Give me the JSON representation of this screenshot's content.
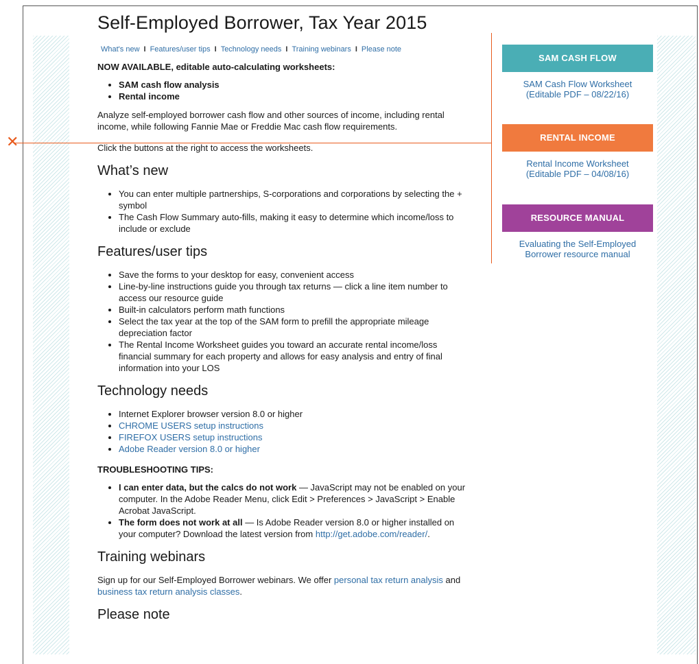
{
  "page_title": "Self-Employed Borrower, Tax Year 2015",
  "topnav": [
    "What's new",
    "Features/user tips",
    "Technology needs",
    "Training webinars",
    "Please note"
  ],
  "topnav_sep": "I",
  "now_available": "NOW AVAILABLE, editable auto-calculating worksheets:",
  "worksheets": [
    "SAM cash flow analysis",
    "Rental income"
  ],
  "intro": "Analyze self-employed borrower cash flow and other sources of income, including rental income, while following Fannie Mae or Freddie Mac cash flow requirements.",
  "click_text": "Click the buttons at the right to access the worksheets.",
  "whats_new": {
    "heading": "What’s new",
    "items": [
      "You can enter multiple partnerships, S-corporations and corporations by selecting the + symbol",
      "The Cash Flow Summary auto-fills, making it easy to determine which income/loss to include or exclude"
    ]
  },
  "features": {
    "heading": "Features/user tips",
    "items": [
      "Save the forms to your desktop for easy, convenient access",
      "Line-by-line instructions guide you through tax returns — click a line item number to access our resource guide",
      "Built-in calculators perform math functions",
      "Select the tax year at the top of the SAM form to prefill the appropriate mileage depreciation factor",
      "The Rental Income Worksheet guides you toward an accurate rental income/loss financial summary for each property and allows for easy analysis and entry of final information into your LOS"
    ]
  },
  "tech": {
    "heading": "Technology needs",
    "item_plain": "Internet Explorer browser version 8.0 or higher",
    "links": [
      "CHROME USERS setup instructions",
      "FIREFOX USERS setup instructions",
      "Adobe Reader version 8.0 or higher"
    ]
  },
  "troubleshooting": {
    "heading": "TROUBLESHOOTING TIPS:",
    "tip1_bold": "I can enter data, but the calcs do not work",
    "tip1_text": " — JavaScript may not be enabled on your computer. In the Adobe Reader Menu, click Edit > Preferences > JavaScript > Enable Acrobat JavaScript.",
    "tip2_bold": "The form does not work at all",
    "tip2_text": " — Is Adobe Reader version 8.0 or higher installed on your computer? Download the latest version from ",
    "tip2_link": "http://get.adobe.com/reader/",
    "tip2_end": "."
  },
  "training": {
    "heading": "Training webinars",
    "text1": "Sign up for our Self-Employed Borrower webinars. We offer ",
    "link1": "personal tax return analysis",
    "text2": " and ",
    "link2": "business tax return analysis classes",
    "text3": "."
  },
  "please_note": {
    "heading": "Please note"
  },
  "sidebar": [
    {
      "button": "SAM CASH FLOW",
      "color": "#4aaeb5",
      "link_line1": "SAM Cash Flow Worksheet",
      "link_line2": "(Editable PDF – 08/22/16)"
    },
    {
      "button": "RENTAL INCOME",
      "color": "#f07a3e",
      "link_line1": "Rental Income Worksheet",
      "link_line2": "(Editable PDF – 04/08/16)"
    },
    {
      "button": "RESOURCE MANUAL",
      "color": "#a0429a",
      "link_line1": "Evaluating the Self-Employed",
      "link_line2": "Borrower resource manual"
    }
  ],
  "marker": "✕"
}
